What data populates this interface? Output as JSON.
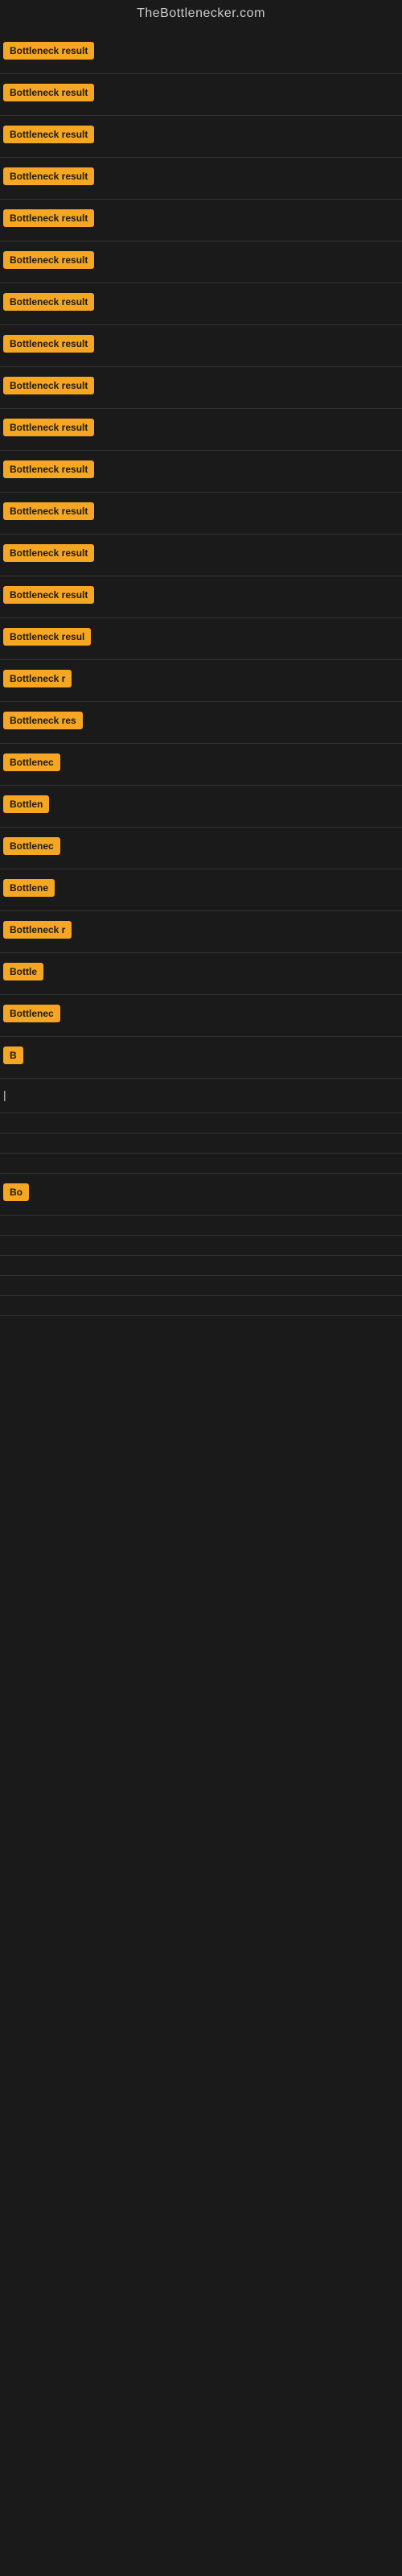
{
  "site": {
    "title": "TheBottlenecker.com"
  },
  "items": [
    {
      "label": "Bottleneck result",
      "width": 130
    },
    {
      "label": "Bottleneck result",
      "width": 130
    },
    {
      "label": "Bottleneck result",
      "width": 130
    },
    {
      "label": "Bottleneck result",
      "width": 130
    },
    {
      "label": "Bottleneck result",
      "width": 130
    },
    {
      "label": "Bottleneck result",
      "width": 130
    },
    {
      "label": "Bottleneck result",
      "width": 130
    },
    {
      "label": "Bottleneck result",
      "width": 130
    },
    {
      "label": "Bottleneck result",
      "width": 130
    },
    {
      "label": "Bottleneck result",
      "width": 130
    },
    {
      "label": "Bottleneck result",
      "width": 130
    },
    {
      "label": "Bottleneck result",
      "width": 130
    },
    {
      "label": "Bottleneck result",
      "width": 130
    },
    {
      "label": "Bottleneck result",
      "width": 130
    },
    {
      "label": "Bottleneck resul",
      "width": 120
    },
    {
      "label": "Bottleneck r",
      "width": 95
    },
    {
      "label": "Bottleneck res",
      "width": 105
    },
    {
      "label": "Bottlenec",
      "width": 85
    },
    {
      "label": "Bottlen",
      "width": 72
    },
    {
      "label": "Bottlenec",
      "width": 85
    },
    {
      "label": "Bottlene",
      "width": 78
    },
    {
      "label": "Bottleneck r",
      "width": 96
    },
    {
      "label": "Bottle",
      "width": 55
    },
    {
      "label": "Bottlenec",
      "width": 85
    },
    {
      "label": "B",
      "width": 18
    },
    {
      "label": "|",
      "width": 10
    },
    {
      "label": "",
      "width": 0
    },
    {
      "label": "",
      "width": 0
    },
    {
      "label": "",
      "width": 0
    },
    {
      "label": "Bo",
      "width": 22
    },
    {
      "label": "",
      "width": 0
    },
    {
      "label": "",
      "width": 0
    },
    {
      "label": "",
      "width": 0
    },
    {
      "label": "",
      "width": 0
    },
    {
      "label": "",
      "width": 0
    }
  ]
}
